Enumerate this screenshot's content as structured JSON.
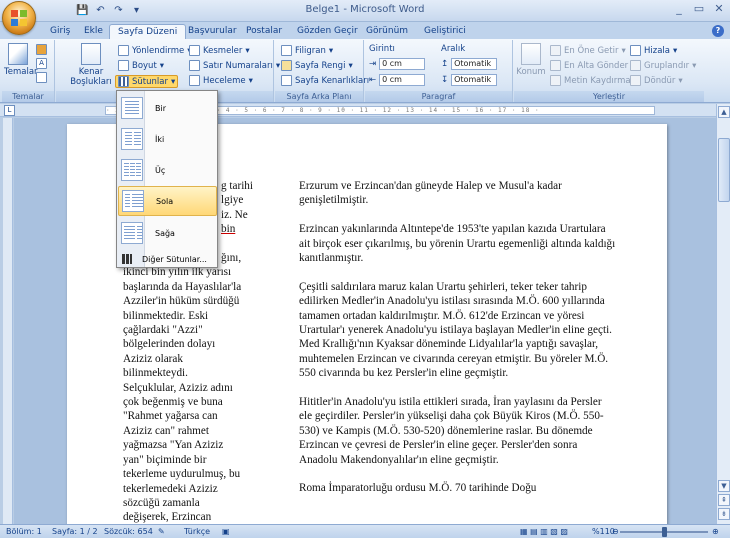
{
  "window": {
    "title": "Belge1 - Microsoft Word",
    "controls": {
      "minimize": "_",
      "restore": "▭",
      "close": "✕"
    }
  },
  "qat": [
    "save-icon",
    "undo-icon",
    "redo-icon",
    "customize-icon"
  ],
  "tabs": [
    {
      "label": "Giriş"
    },
    {
      "label": "Ekle"
    },
    {
      "label": "Sayfa Düzeni",
      "active": true
    },
    {
      "label": "Başvurular"
    },
    {
      "label": "Postalar"
    },
    {
      "label": "Gözden Geçir"
    },
    {
      "label": "Görünüm"
    },
    {
      "label": "Geliştirici"
    }
  ],
  "ribbon": {
    "temalar": {
      "group_label": "Temalar",
      "button": "Temalar"
    },
    "sayfa_yapisi": {
      "kenar_bosluklari": "Kenar\nBoşlukları",
      "yonlendirme": "Yönlendirme",
      "boyut": "Boyut",
      "sutunlar": "Sütunlar",
      "kesmeler": "Kesmeler",
      "satir_numaralari": "Satır Numaraları",
      "heceleme": "Heceleme"
    },
    "sayfa_arka_plani": {
      "group_label": "Sayfa Arka Planı",
      "filigran": "Filigran",
      "sayfa_rengi": "Sayfa Rengi",
      "sayfa_kenarliklari": "Sayfa Kenarlıkları"
    },
    "paragraf": {
      "group_label": "Paragraf",
      "girinti": "Girintı",
      "girinti_label": "Girintı",
      "aralik": "Aralık",
      "left_value": "0 cm",
      "right_value": "0 cm",
      "before_value": "Otomatik",
      "after_value": "Otomatik"
    },
    "yerlestir": {
      "group_label": "Yerleştir",
      "konum": "Konum",
      "en_one_getir": "En Öne Getir",
      "en_alta_gonder": "En Alta Gönder",
      "metin_kaydirma": "Metin Kaydırma",
      "hizala": "Hizala",
      "grupla": "Gruplandır",
      "dondur": "Döndür"
    }
  },
  "columns_menu": {
    "items": [
      "Bir",
      "İki",
      "Üç",
      "Sola",
      "Sağa"
    ],
    "highlighted": "Sola",
    "more": "Diğer Sütunlar..."
  },
  "ruler": "· 2 · 1 · · · 1 · 2 · 3 · 4 · 5 · 6 · 7 · 8 · 9 · 10 · 11 · 12 · 13 · 14 · 15 · 16 · 17 · 18 ·",
  "document": {
    "col1_lines": [
      "g tarihi",
      "lgiye",
      "iz. Ne",
      "bin",
      "",
      "ğını,",
      "ikinci bin yılın ilk yarısı",
      "başlarında da Hayaslılar'la",
      "Azziler'in hüküm sürdüğü",
      "bilinmektedir. Eski",
      "çağlardaki \"Azzi\"",
      "bölgelerinden dolayı",
      "Aziziz olarak",
      "bilinmekteydi.",
      "Selçuklular, Aziziz adını",
      "çok beğenmiş ve buna",
      "\"Rahmet yağarsa can",
      "Aziziz can\" rahmet",
      "yağmazsa \"Yan Aziziz",
      "yan\" biçiminde bir",
      "tekerleme uydurulmuş, bu",
      "tekerlemedeki Aziziz",
      "sözcüğü zamanla",
      "değişerek, Erzincan"
    ],
    "col2_paragraphs": [
      "Erzurum ve Erzincan'dan güneyde Halep ve Musul'a kadar genişletilmiştir.",
      "Erzincan yakınlarında Altıntepe'de 1953'te yapılan kazıda Urartulara ait birçok eser çıkarılmış, bu yörenin Urartu egemenliği altında kaldığı kanıtlanmıştır.",
      "Çeşitli saldırılara maruz kalan Urartu şehirleri, teker teker tahrip edilirken Medler'in Anadolu'yu istilası sırasında M.Ö. 600 yıllarında tamamen ortadan kaldırılmıştır. M.Ö. 612'de Erzincan ve yöresi Urartular'ı yenerek Anadolu'yu istilaya başlayan Medler'in eline geçti. Med Krallığı'nın Kyaksar döneminde Lidyalılar'la yaptığı savaşlar, muhtemelen Erzincan ve civarında cereyan etmiştir. Bu yöreler M.Ö. 550 civarında bu kez Persler'in eline geçmiştir.",
      "Hititler'in Anadolu'yu istila ettikleri sırada, İran yaylasını da Persler ele geçirdiler. Persler'in yükselişi daha çok Büyük Kiros (M.Ö. 550-530) ve Kampis (M.Ö. 530-520) dönemlerine raslar. Bu dönemde Erzincan ve çevresi de Persler'in eline geçer. Persler'den sonra Anadolu Makendonyalılar'ın eline geçmiştir.",
      "Roma İmparatorluğu ordusu M.Ö. 70 tarihinde Doğu"
    ]
  },
  "status": {
    "section": "Bölüm: 1",
    "page": "Sayfa: 1 / 2",
    "words": "Sözcük: 654",
    "language": "Türkçe",
    "zoom": "%110",
    "zoom_fraction": 0.5
  },
  "colors": {
    "accent": "#ffd877",
    "ribbon": "#dbe7f5",
    "text": "#15428b"
  }
}
